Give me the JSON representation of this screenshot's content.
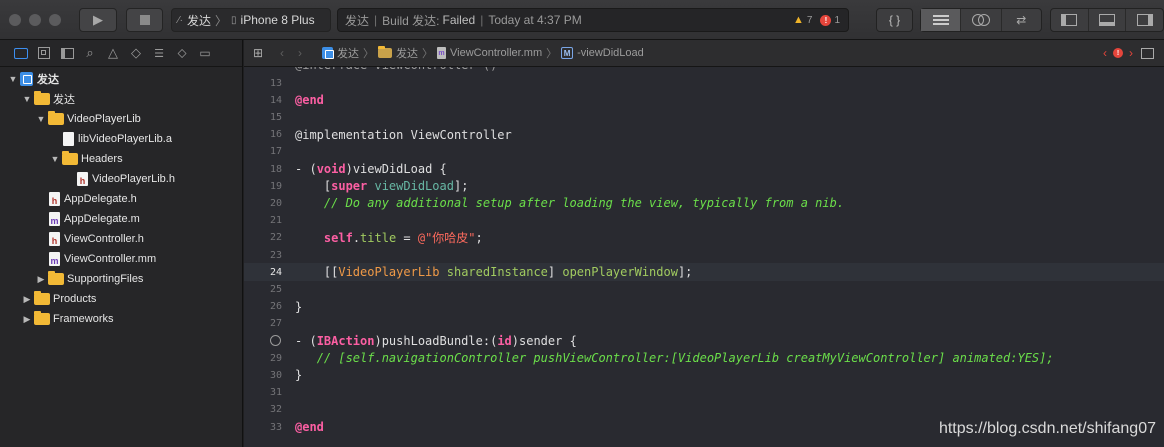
{
  "toolbar": {
    "scheme_project": "发达",
    "scheme_device": "iPhone 8 Plus",
    "activity": {
      "project": "发达",
      "status_prefix": "Build 发达:",
      "status_result": "Failed",
      "time": "Today at 4:37 PM",
      "warning_count": "7",
      "error_count": "1"
    }
  },
  "sidebar": {
    "tree": [
      {
        "label": "发达",
        "kind": "project",
        "depth": 0,
        "expanded": true
      },
      {
        "label": "发达",
        "kind": "folder",
        "depth": 1,
        "expanded": true
      },
      {
        "label": "VideoPlayerLib",
        "kind": "folder",
        "depth": 2,
        "expanded": true
      },
      {
        "label": "libVideoPlayerLib.a",
        "kind": "file",
        "icon": "",
        "depth": 3
      },
      {
        "label": "Headers",
        "kind": "folder",
        "depth": 3,
        "expanded": true
      },
      {
        "label": "VideoPlayerLib.h",
        "kind": "file",
        "icon": "h",
        "depth": 4
      },
      {
        "label": "AppDelegate.h",
        "kind": "file",
        "icon": "h",
        "depth": 2
      },
      {
        "label": "AppDelegate.m",
        "kind": "file",
        "icon": "m",
        "depth": 2
      },
      {
        "label": "ViewController.h",
        "kind": "file",
        "icon": "h",
        "depth": 2
      },
      {
        "label": "ViewController.mm",
        "kind": "file",
        "icon": "m",
        "depth": 2
      },
      {
        "label": "SupportingFiles",
        "kind": "folder",
        "depth": 2,
        "expanded": false
      },
      {
        "label": "Products",
        "kind": "folder",
        "depth": 1,
        "expanded": false
      },
      {
        "label": "Frameworks",
        "kind": "folder",
        "depth": 1,
        "expanded": false
      }
    ]
  },
  "editor": {
    "breadcrumb": [
      "发达",
      "发达",
      "ViewController.mm",
      "-viewDidLoad"
    ],
    "current_line": "24",
    "lines": [
      {
        "n": "13",
        "html": ""
      },
      {
        "n": "14",
        "html": "<span class=\"kw\">@end</span>"
      },
      {
        "n": "15",
        "html": ""
      },
      {
        "n": "16",
        "html": "@implementation ViewController"
      },
      {
        "n": "17",
        "html": ""
      },
      {
        "n": "18",
        "html": "- (<span class=\"kw\">void</span>)viewDidLoad {"
      },
      {
        "n": "19",
        "html": "    [<span class=\"kw\">super</span> <span class=\"meth\">viewDidLoad</span>];"
      },
      {
        "n": "20",
        "html": "    <span class=\"cmt\">// Do any additional setup after loading the view, typically from a nib.</span>"
      },
      {
        "n": "21",
        "html": ""
      },
      {
        "n": "22",
        "html": "    <span class=\"slf\">self</span>.<span class=\"prop\">title</span> = <span class=\"str\">@\"你哈皮\"</span>;"
      },
      {
        "n": "23",
        "html": ""
      },
      {
        "n": "24",
        "html": "    [[<span class=\"typ\">VideoPlayerLib</span> <span class=\"prop\">sharedInstance</span>] <span class=\"prop\">openPlayerWindow</span>];"
      },
      {
        "n": "25",
        "html": ""
      },
      {
        "n": "26",
        "html": "}"
      },
      {
        "n": "27",
        "html": ""
      },
      {
        "n": "28",
        "html": "- (<span class=\"kw\">IBAction</span>)pushLoadBundle:(<span class=\"kw\">id</span>)sender {"
      },
      {
        "n": "29",
        "html": "   <span class=\"cmt\">// [self.navigationController pushViewController:[VideoPlayerLib creatMyViewController] animated:YES];</span>"
      },
      {
        "n": "30",
        "html": "}"
      },
      {
        "n": "31",
        "html": ""
      },
      {
        "n": "32",
        "html": ""
      },
      {
        "n": "33",
        "html": "<span class=\"kw\">@end</span>"
      }
    ],
    "breakpoint_line": "28"
  },
  "watermark": "https://blog.csdn.net/shifang07",
  "colors": {
    "warning": "#f0b429",
    "error": "#e5453b",
    "folder": "#f2b936",
    "selection": "#5a5a5c"
  }
}
